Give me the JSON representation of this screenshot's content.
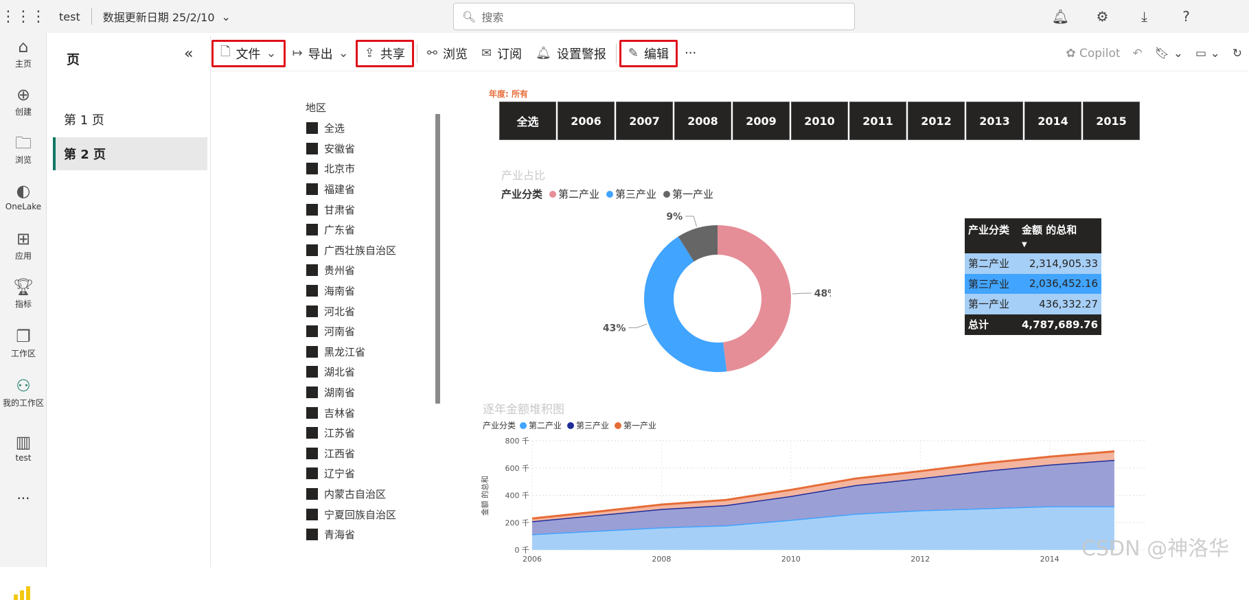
{
  "topbar": {
    "waffle_icon": "app-launcher-icon",
    "workspace_title": "test",
    "data_update_label": "数据更新日期 25/2/10",
    "search_placeholder": "搜索",
    "icons": [
      "bell-icon",
      "gear-icon",
      "download-icon",
      "help-icon",
      "account-icon"
    ]
  },
  "leftnav": {
    "items": [
      {
        "icon": "home-icon",
        "label": "主页"
      },
      {
        "icon": "plus-circle-icon",
        "label": "创建"
      },
      {
        "icon": "folder-icon",
        "label": "浏览"
      },
      {
        "icon": "onelake-icon",
        "label": "OneLake"
      },
      {
        "icon": "apps-icon",
        "label": "应用"
      },
      {
        "icon": "trophy-icon",
        "label": "指标"
      },
      {
        "icon": "workspaces-icon",
        "label": "工作区"
      },
      {
        "icon": "person-icon",
        "label": "我的工作区"
      },
      {
        "icon": "report-icon",
        "label": "test"
      }
    ],
    "more": "···"
  },
  "pages_panel": {
    "title": "页",
    "collapse_icon": "double-chevron-left-icon",
    "pages": [
      {
        "label": "第 1 页",
        "active": false
      },
      {
        "label": "第 2 页",
        "active": true
      }
    ]
  },
  "toolbar": {
    "file_label": "文件",
    "export_label": "导出",
    "share_label": "共享",
    "browse_label": "浏览",
    "subscribe_label": "订阅",
    "alert_label": "设置警报",
    "edit_label": "编辑",
    "more_label": "···",
    "copilot_label": "Copilot"
  },
  "slicer": {
    "title": "地区",
    "items": [
      "全选",
      "安徽省",
      "北京市",
      "福建省",
      "甘肃省",
      "广东省",
      "广西壮族自治区",
      "贵州省",
      "海南省",
      "河北省",
      "河南省",
      "黑龙江省",
      "湖北省",
      "湖南省",
      "吉林省",
      "江苏省",
      "江西省",
      "辽宁省",
      "内蒙古自治区",
      "宁夏回族自治区",
      "青海省"
    ]
  },
  "year_slicer": {
    "label": "年度: 所有",
    "years": [
      "全选",
      "2006",
      "2007",
      "2008",
      "2009",
      "2010",
      "2011",
      "2012",
      "2013",
      "2014",
      "2015"
    ]
  },
  "donut": {
    "title": "产业占比",
    "legend_title": "产业分类",
    "colors": [
      "#e58e97",
      "#41a4ff",
      "#666666"
    ],
    "chart_data": {
      "type": "pie",
      "title": "产业占比",
      "categories": [
        "第二产业",
        "第三产业",
        "第一产业"
      ],
      "values": [
        48,
        43,
        9
      ],
      "labels": [
        "48%",
        "43%",
        "9%"
      ]
    }
  },
  "matrix": {
    "headers": [
      "产业分类",
      "金额 的总和"
    ],
    "rows": [
      {
        "name": "第二产业",
        "value": "2,314,905.33"
      },
      {
        "name": "第三产业",
        "value": "2,036,452.16"
      },
      {
        "name": "第一产业",
        "value": "436,332.27"
      }
    ],
    "total_label": "总计",
    "total_value": "4,787,689.76"
  },
  "area": {
    "title": "逐年金额堆积图",
    "legend_title": "产业分类",
    "colors": [
      "#41a4ff",
      "#1f2d99",
      "#e66c37"
    ],
    "chart_data": {
      "type": "area",
      "title": "逐年金额堆积图",
      "ylabel": "金额 的总和",
      "x": [
        2006,
        2007,
        2008,
        2009,
        2010,
        2011,
        2012,
        2013,
        2014,
        2015
      ],
      "x_ticks": [
        "2006",
        "2008",
        "2010",
        "2012",
        "2014"
      ],
      "y_ticks": [
        "0 千",
        "200 千",
        "400 千",
        "600 千",
        "800 千"
      ],
      "ylim": [
        0,
        800
      ],
      "stacked": true,
      "series": [
        {
          "name": "第二产业",
          "values": [
            115,
            140,
            165,
            180,
            220,
            265,
            290,
            305,
            320,
            320
          ]
        },
        {
          "name": "第三产业",
          "values": [
            95,
            115,
            135,
            148,
            175,
            210,
            235,
            275,
            305,
            340
          ]
        },
        {
          "name": "第一产业",
          "values": [
            20,
            25,
            32,
            38,
            45,
            48,
            52,
            55,
            58,
            62
          ]
        }
      ]
    }
  },
  "watermark": "CSDN @神洛华"
}
